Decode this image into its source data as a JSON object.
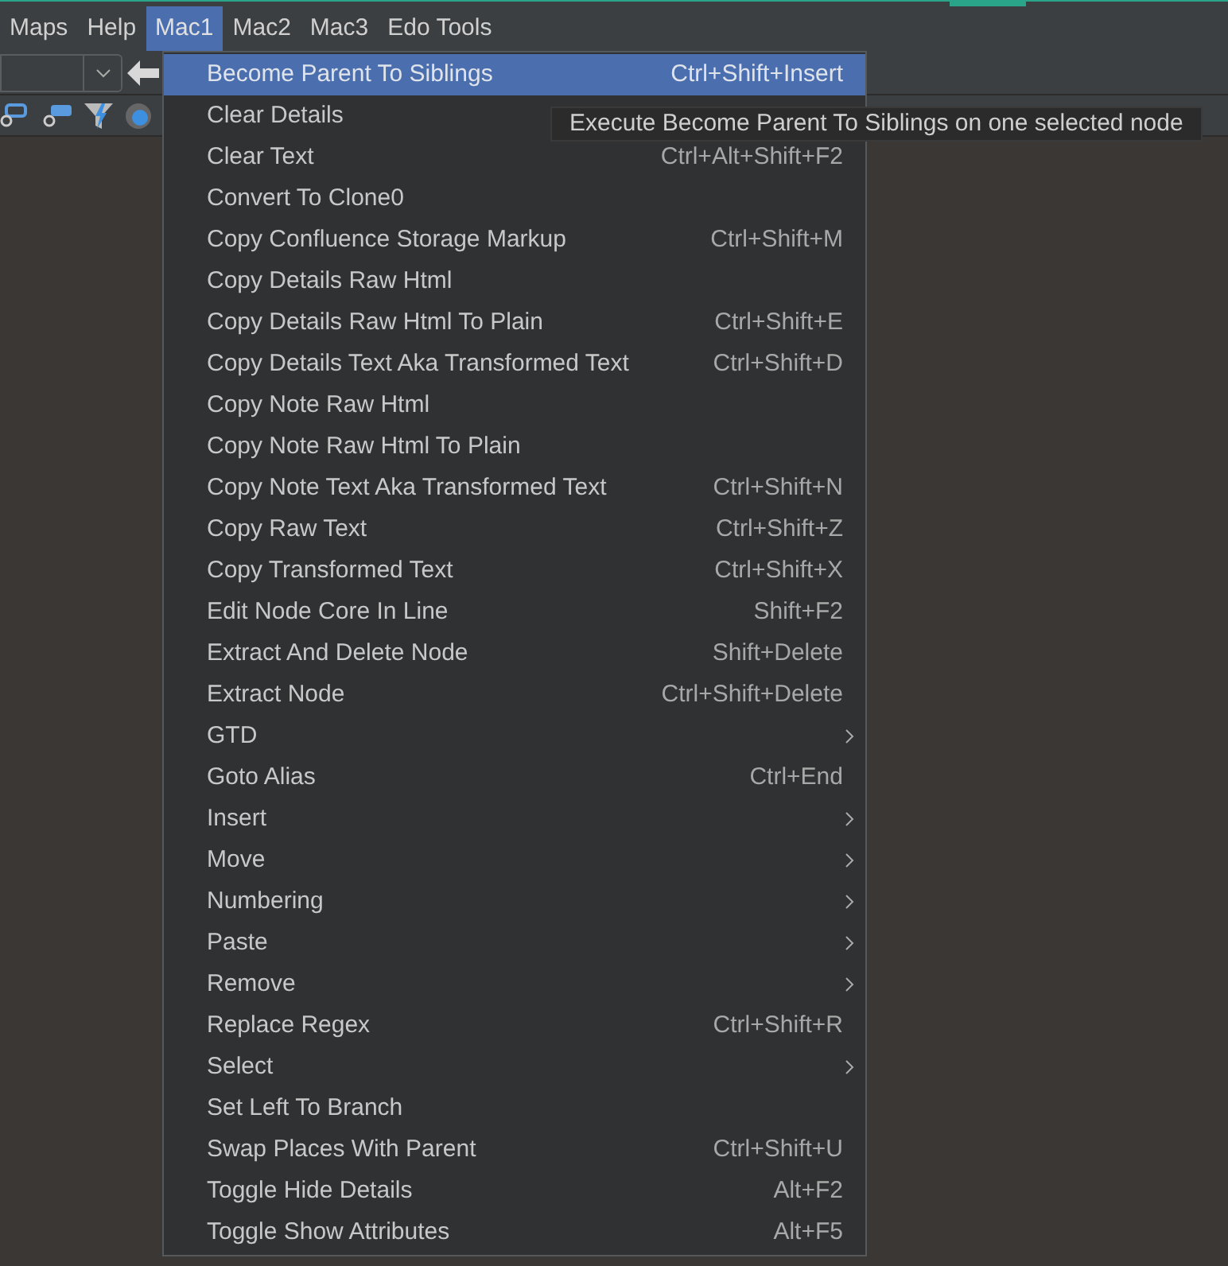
{
  "menu_bar": [
    {
      "label": "Maps",
      "selected": false
    },
    {
      "label": "Help",
      "selected": false
    },
    {
      "label": "Mac1",
      "selected": true
    },
    {
      "label": "Mac2",
      "selected": false
    },
    {
      "label": "Mac3",
      "selected": false
    },
    {
      "label": "Edo Tools",
      "selected": false
    }
  ],
  "menu": {
    "items": [
      {
        "label": "Become Parent To Siblings",
        "shortcut": "Ctrl+Shift+Insert",
        "kind": "action",
        "selected": true
      },
      {
        "label": "Clear Details",
        "kind": "action",
        "selected": false
      },
      {
        "label": "Clear Text",
        "shortcut": "Ctrl+Alt+Shift+F2",
        "kind": "action",
        "selected": false
      },
      {
        "label": "Convert To Clone0",
        "kind": "action",
        "selected": false
      },
      {
        "label": "Copy Confluence Storage Markup",
        "shortcut": "Ctrl+Shift+M",
        "kind": "action",
        "selected": false
      },
      {
        "label": "Copy Details Raw Html",
        "kind": "action",
        "selected": false
      },
      {
        "label": "Copy Details Raw Html To Plain",
        "shortcut": "Ctrl+Shift+E",
        "kind": "action",
        "selected": false
      },
      {
        "label": "Copy Details Text Aka Transformed Text",
        "shortcut": "Ctrl+Shift+D",
        "kind": "action",
        "selected": false
      },
      {
        "label": "Copy Note Raw Html",
        "kind": "action",
        "selected": false
      },
      {
        "label": "Copy Note Raw Html To Plain",
        "kind": "action",
        "selected": false
      },
      {
        "label": "Copy Note Text Aka Transformed Text",
        "shortcut": "Ctrl+Shift+N",
        "kind": "action",
        "selected": false
      },
      {
        "label": "Copy Raw Text",
        "shortcut": "Ctrl+Shift+Z",
        "kind": "action",
        "selected": false
      },
      {
        "label": "Copy Transformed Text",
        "shortcut": "Ctrl+Shift+X",
        "kind": "action",
        "selected": false
      },
      {
        "label": "Edit Node Core In Line",
        "shortcut": "Shift+F2",
        "kind": "action",
        "selected": false
      },
      {
        "label": "Extract And Delete Node",
        "shortcut": "Shift+Delete",
        "kind": "action",
        "selected": false
      },
      {
        "label": "Extract Node",
        "shortcut": "Ctrl+Shift+Delete",
        "kind": "action",
        "selected": false
      },
      {
        "label": "GTD",
        "kind": "submenu",
        "selected": false
      },
      {
        "label": "Goto Alias",
        "shortcut": "Ctrl+End",
        "kind": "action",
        "selected": false
      },
      {
        "label": "Insert",
        "kind": "submenu",
        "selected": false
      },
      {
        "label": "Move",
        "kind": "submenu",
        "selected": false
      },
      {
        "label": "Numbering",
        "kind": "submenu",
        "selected": false
      },
      {
        "label": "Paste",
        "kind": "submenu",
        "selected": false
      },
      {
        "label": "Remove",
        "kind": "submenu",
        "selected": false
      },
      {
        "label": "Replace Regex",
        "shortcut": "Ctrl+Shift+R",
        "kind": "action",
        "selected": false
      },
      {
        "label": "Select",
        "kind": "submenu",
        "selected": false
      },
      {
        "label": "Set Left To Branch",
        "kind": "action",
        "selected": false
      },
      {
        "label": "Swap Places With Parent",
        "shortcut": "Ctrl+Shift+U",
        "kind": "action",
        "selected": false
      },
      {
        "label": "Toggle Hide Details",
        "shortcut": "Alt+F2",
        "kind": "action",
        "selected": false
      },
      {
        "label": "Toggle Show Attributes",
        "shortcut": "Alt+F5",
        "kind": "action",
        "selected": false
      }
    ]
  },
  "tooltip": {
    "text": "Execute Become Parent To Siblings on one selected node"
  }
}
